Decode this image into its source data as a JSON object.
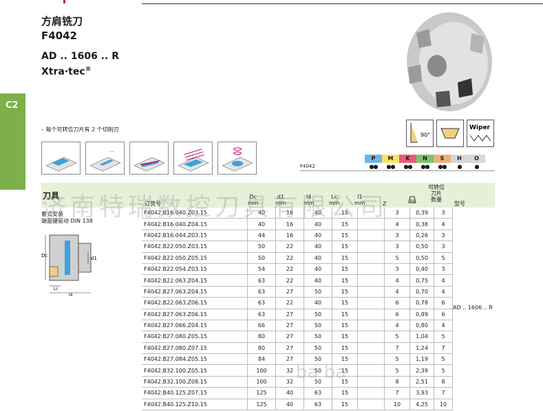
{
  "header": {
    "title_cn": "方肩铣刀",
    "code": "F4042",
    "insert_type": "AD .. 1606 .. R",
    "brand": "Xtra·tec",
    "reg": "®"
  },
  "side_tab": "C2",
  "note": "– 每个可转位刀片有 2 个切削刃",
  "icons": {
    "angle": "90°",
    "wiper": "Wiper"
  },
  "materials": [
    {
      "code": "P",
      "color": "#6fb4e8",
      "dots": "●●"
    },
    {
      "code": "M",
      "color": "#f4e46a",
      "dots": "●●"
    },
    {
      "code": "K",
      "color": "#e85a7a",
      "dots": "●●"
    },
    {
      "code": "N",
      "color": "#79c36b",
      "dots": "●●"
    },
    {
      "code": "S",
      "color": "#eab17a",
      "dots": "●●"
    },
    {
      "code": "H",
      "color": "#d7d7d7",
      "dots": "●"
    },
    {
      "code": "O",
      "color": "#d7d7d7",
      "dots": "●"
    }
  ],
  "f4042_label": "F4042",
  "section_title": "刀具",
  "columns": {
    "order": "订货号",
    "dc": "Dc",
    "dc_unit": "mm",
    "d1": "d1",
    "d1_unit": "mm",
    "l4": "l4",
    "l4_unit": "mm",
    "lc": "Lc",
    "lc_unit": "mm",
    "l1": "l1",
    "l1_unit": "mm",
    "z": "Z",
    "kg": "kg",
    "inserts_1": "可转位",
    "inserts_2": "刀片",
    "inserts_3": "数量",
    "type": "型号"
  },
  "mount_desc_1": "套式安装",
  "mount_desc_2": "端面键驱动 DIN 138",
  "diagram_labels": {
    "dc": "Dc",
    "d1": "d1",
    "lc": "Lc",
    "l4": "l4"
  },
  "rows": [
    [
      "F4042.B16.040.Z03.15",
      "40",
      "16",
      "40",
      "15",
      "3",
      "0,39",
      "3"
    ],
    [
      "F4042.B16.040.Z04.15",
      "40",
      "16",
      "40",
      "15",
      "4",
      "0,38",
      "4"
    ],
    [
      "F4042.B16.044.Z03.15",
      "44",
      "16",
      "40",
      "15",
      "3",
      "0,26",
      "3"
    ],
    [
      "F4042.B22.050.Z03.15",
      "50",
      "22",
      "40",
      "15",
      "3",
      "0,50",
      "3"
    ],
    [
      "F4042.B22.050.Z05.15",
      "50",
      "22",
      "40",
      "15",
      "5",
      "0,50",
      "5"
    ],
    [
      "F4042.B22.054.Z03.15",
      "54",
      "22",
      "40",
      "15",
      "3",
      "0,40",
      "3"
    ],
    [
      "F4042.B22.063.Z04.15",
      "63",
      "22",
      "40",
      "15",
      "4",
      "0,75",
      "4"
    ],
    [
      "F4042.B27.063.Z04.15",
      "63",
      "27",
      "50",
      "15",
      "4",
      "0,70",
      "4"
    ],
    [
      "F4042.B22.063.Z06.15",
      "63",
      "22",
      "40",
      "15",
      "6",
      "0,78",
      "6"
    ],
    [
      "F4042.B27.063.Z06.15",
      "63",
      "27",
      "50",
      "15",
      "6",
      "0,89",
      "6"
    ],
    [
      "F4042.B27.066.Z04.15",
      "66",
      "27",
      "50",
      "15",
      "4",
      "0,80",
      "4"
    ],
    [
      "F4042.B27.080.Z05.15",
      "80",
      "27",
      "50",
      "15",
      "5",
      "1,04",
      "5"
    ],
    [
      "F4042.B27.080.Z07.15",
      "80",
      "27",
      "50",
      "15",
      "7",
      "1,24",
      "7"
    ],
    [
      "F4042.B27.084.Z05.15",
      "84",
      "27",
      "50",
      "15",
      "5",
      "1,19",
      "5"
    ],
    [
      "F4042.B32.100.Z05.15",
      "100",
      "32",
      "50",
      "15",
      "5",
      "2,39",
      "5"
    ],
    [
      "F4042.B32.100.Z08.15",
      "100",
      "32",
      "50",
      "15",
      "8",
      "2,51",
      "8"
    ],
    [
      "F4042.B40.125.Z07.15",
      "125",
      "40",
      "63",
      "15",
      "7",
      "3,93",
      "7"
    ],
    [
      "F4042.B40.125.Z10.15",
      "125",
      "40",
      "63",
      "15",
      "10",
      "4,25",
      "10"
    ]
  ],
  "insert_model": "AD .. 1606 .. R",
  "watermark": "济南特瑞数控刀具有限公司",
  "watermark2": "ba ba"
}
